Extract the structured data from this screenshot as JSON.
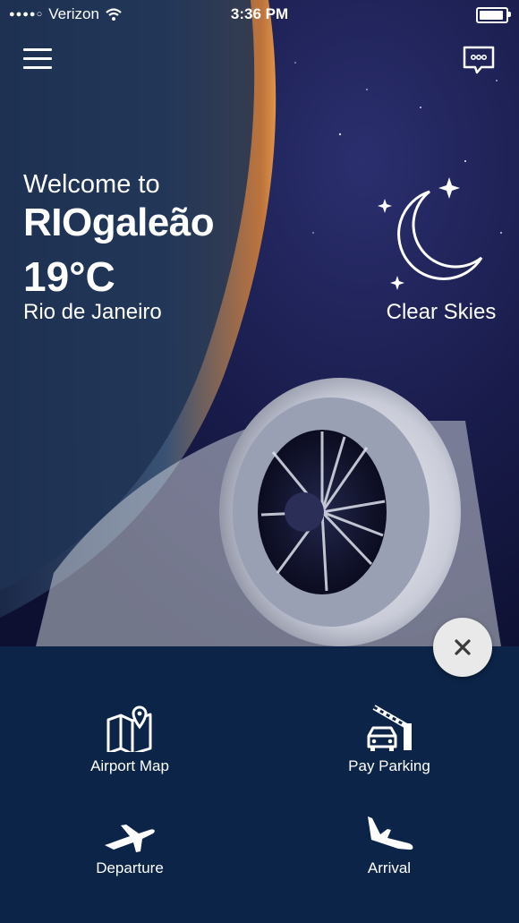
{
  "status": {
    "carrier": "Verizon",
    "signal_dots": "●●●●○",
    "time": "3:36 PM"
  },
  "header": {
    "menu_icon": "hamburger-menu-icon",
    "chat_icon": "chat-bubble-icon"
  },
  "hero": {
    "welcome": "Welcome to",
    "airport": "RIOgaleão",
    "temperature": "19°C",
    "city": "Rio de Janeiro",
    "weather_icon": "moon-stars-icon",
    "condition": "Clear Skies"
  },
  "close_icon": "close-icon",
  "actions": [
    {
      "label": "Airport Map",
      "icon": "map-pin-icon"
    },
    {
      "label": "Pay Parking",
      "icon": "parking-gate-icon"
    },
    {
      "label": "Departure",
      "icon": "departure-plane-icon"
    },
    {
      "label": "Arrival",
      "icon": "arrival-plane-icon"
    }
  ],
  "colors": {
    "panel": "#0c2447",
    "sky": "#1a1d4d",
    "close_bg": "#e9e9e9"
  }
}
